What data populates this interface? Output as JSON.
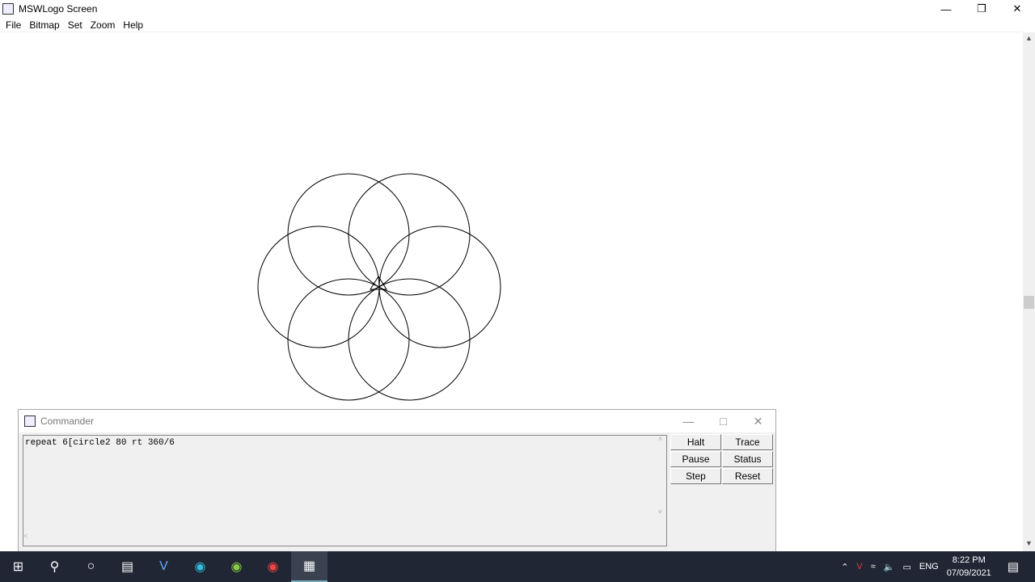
{
  "window": {
    "title": "MSWLogo Screen"
  },
  "menu": [
    "File",
    "Bitmap",
    "Set",
    "Zoom",
    "Help"
  ],
  "commander": {
    "title": "Commander",
    "input_text": "repeat 6[circle2 80 rt 360/6",
    "buttons": [
      "Halt",
      "Trace",
      "Pause",
      "Status",
      "Step",
      "Reset"
    ]
  },
  "taskbar": {
    "time": "8:22 PM",
    "date": "07/09/2021",
    "lang": "ENG"
  }
}
